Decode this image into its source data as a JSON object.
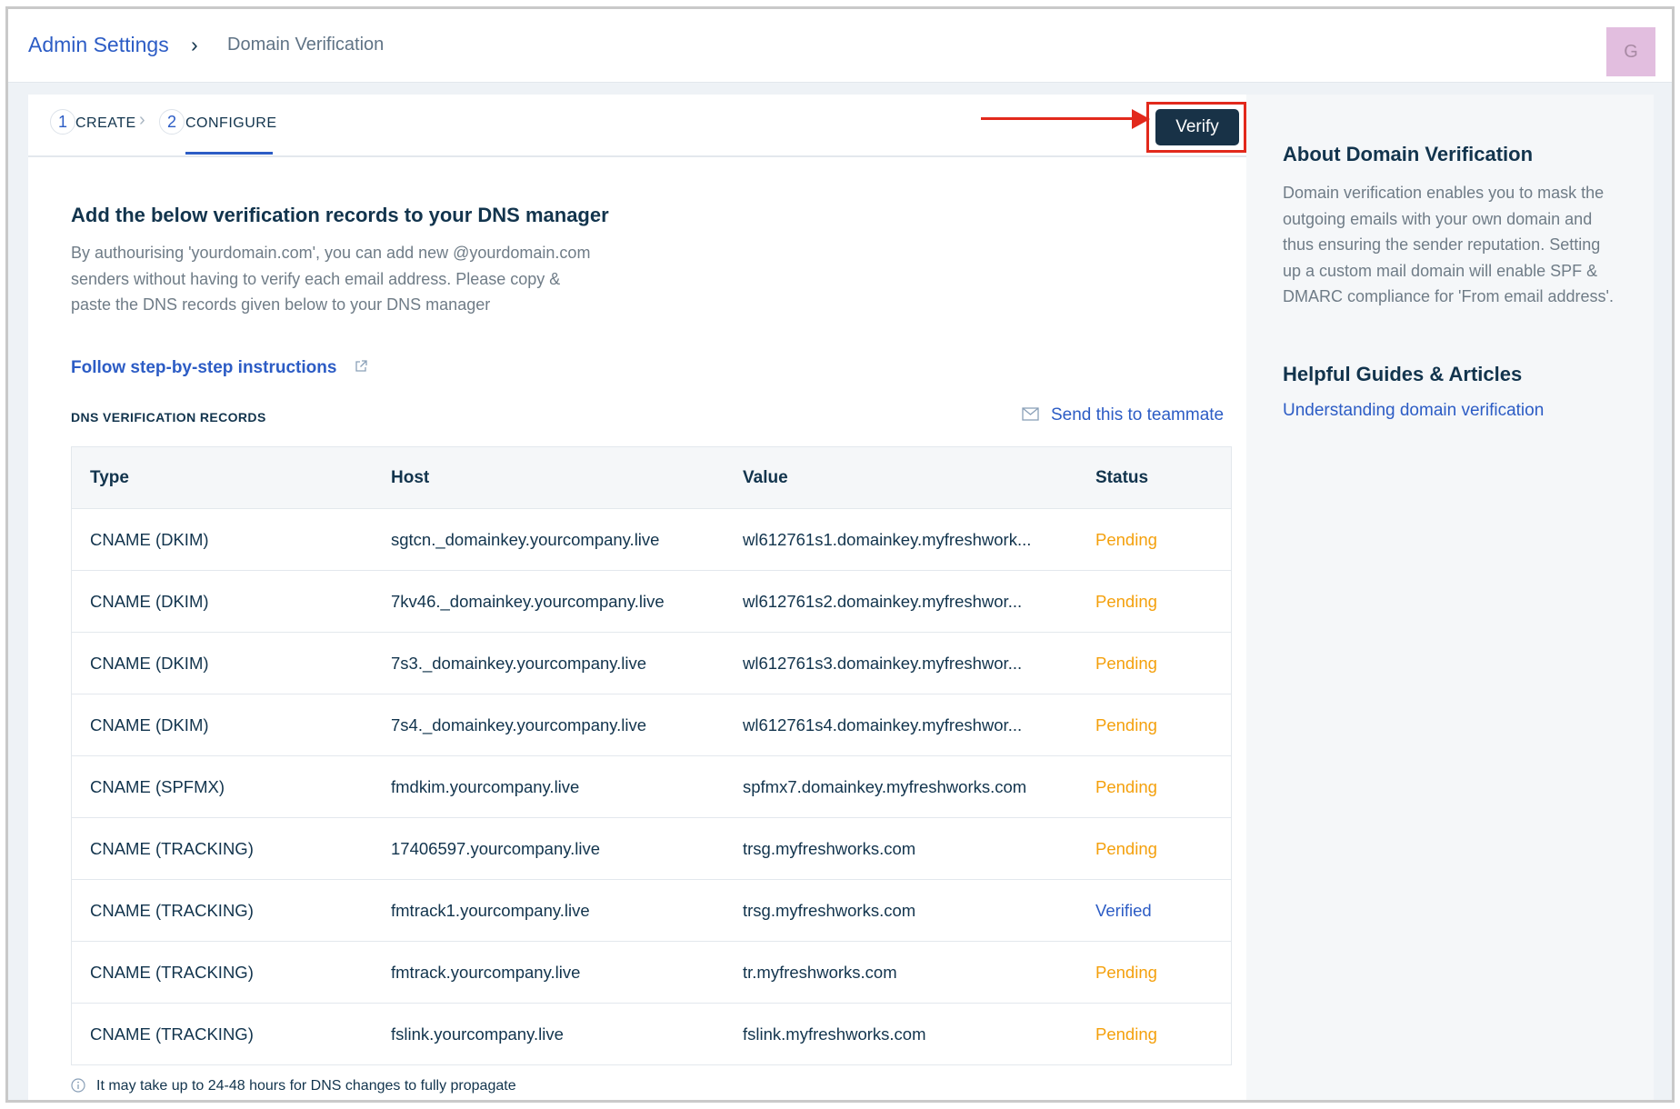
{
  "breadcrumb": {
    "root": "Admin Settings",
    "separator": "›",
    "current": "Domain Verification"
  },
  "avatar": {
    "initial": "G"
  },
  "steps": [
    {
      "number": "1",
      "label": "CREATE"
    },
    {
      "number": "2",
      "label": "CONFIGURE"
    }
  ],
  "step_separator": "›",
  "verify_button": "Verify",
  "main": {
    "heading": "Add the below verification records to your DNS manager",
    "description": "By authourising 'yourdomain.com', you can add new @yourdomain.com senders without having to verify each email address. Please copy & paste the DNS records given below to your DNS manager",
    "instructions_link": "Follow step-by-step instructions",
    "records_label": "DNS VERIFICATION RECORDS",
    "send_link": "Send this to teammate",
    "footnote": "It may take up to 24-48 hours for DNS changes to fully propagate"
  },
  "table": {
    "headers": {
      "type": "Type",
      "host": "Host",
      "value": "Value",
      "status": "Status"
    },
    "rows": [
      {
        "type": "CNAME (DKIM)",
        "host": "sgtcn._domainkey.yourcompany.live",
        "value": "wl612761s1.domainkey.myfreshwork...",
        "status": "Pending"
      },
      {
        "type": "CNAME (DKIM)",
        "host": "7kv46._domainkey.yourcompany.live",
        "value": "wl612761s2.domainkey.myfreshwor...",
        "status": "Pending"
      },
      {
        "type": "CNAME (DKIM)",
        "host": "7s3._domainkey.yourcompany.live",
        "value": "wl612761s3.domainkey.myfreshwor...",
        "status": "Pending"
      },
      {
        "type": "CNAME (DKIM)",
        "host": "7s4._domainkey.yourcompany.live",
        "value": "wl612761s4.domainkey.myfreshwor...",
        "status": "Pending"
      },
      {
        "type": "CNAME (SPFMX)",
        "host": "fmdkim.yourcompany.live",
        "value": "spfmx7.domainkey.myfreshworks.com",
        "status": "Pending"
      },
      {
        "type": "CNAME (TRACKING)",
        "host": "17406597.yourcompany.live",
        "value": "trsg.myfreshworks.com",
        "status": "Pending"
      },
      {
        "type": "CNAME (TRACKING)",
        "host": "fmtrack1.yourcompany.live",
        "value": "trsg.myfreshworks.com",
        "status": "Verified"
      },
      {
        "type": "CNAME (TRACKING)",
        "host": "fmtrack.yourcompany.live",
        "value": "tr.myfreshworks.com",
        "status": "Pending"
      },
      {
        "type": "CNAME (TRACKING)",
        "host": "fslink.yourcompany.live",
        "value": "fslink.myfreshworks.com",
        "status": "Pending"
      }
    ]
  },
  "sidebar": {
    "about_title": "About Domain Verification",
    "about_text": "Domain verification enables you to mask the outgoing emails with your own domain and thus ensuring the sender reputation. Setting up a custom mail domain will enable SPF & DMARC compliance for 'From email address'.",
    "guides_title": "Helpful Guides & Articles",
    "guides_link": "Understanding domain verification"
  },
  "icons": {
    "external_link": "external-link-icon",
    "send": "mail-icon",
    "info": "info-icon",
    "annotation": "red-arrow-icon"
  },
  "colors": {
    "link": "#2c5cc5",
    "pending": "#f4a00c",
    "verified": "#2c5cc5",
    "primary_button": "#183247",
    "annotation": "#e2291c"
  }
}
